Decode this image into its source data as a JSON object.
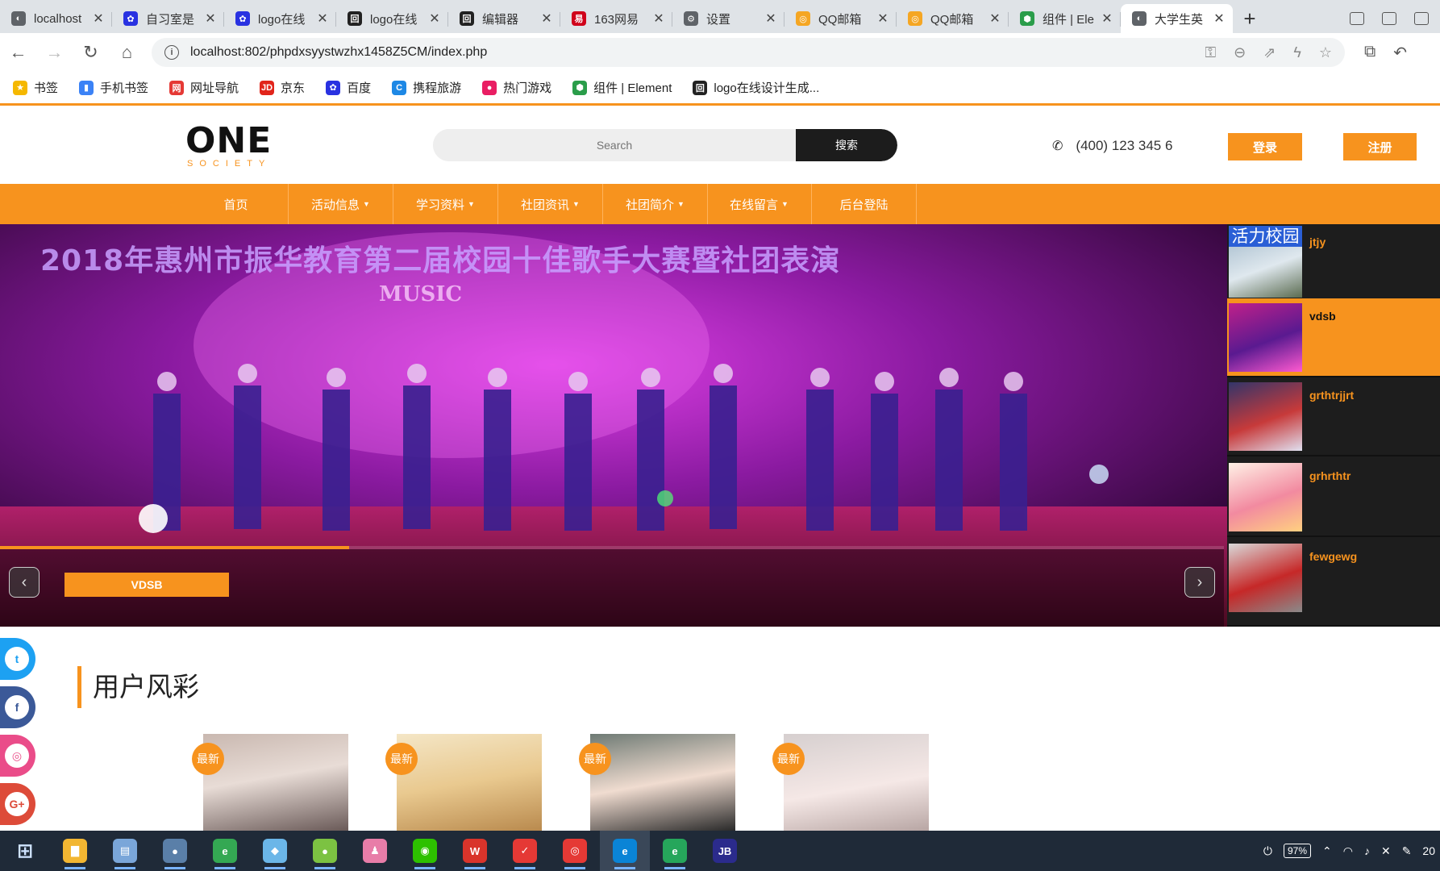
{
  "browser": {
    "tabs": [
      {
        "label": "localhost",
        "favicon_color": "#5f6368",
        "favicon": "◐"
      },
      {
        "label": "自习室是",
        "favicon_color": "#2932e1",
        "favicon": "✿"
      },
      {
        "label": "logo在线",
        "favicon_color": "#2932e1",
        "favicon": "✿"
      },
      {
        "label": "logo在线",
        "favicon_color": "#222222",
        "favicon": "回"
      },
      {
        "label": "编辑器",
        "favicon_color": "#222222",
        "favicon": "回"
      },
      {
        "label": "163网易",
        "favicon_color": "#d0021b",
        "favicon": "易"
      },
      {
        "label": "设置",
        "favicon_color": "#5f6368",
        "favicon": "⚙"
      },
      {
        "label": "QQ邮箱",
        "favicon_color": "#f5a623",
        "favicon": "◎"
      },
      {
        "label": "QQ邮箱",
        "favicon_color": "#f5a623",
        "favicon": "◎"
      },
      {
        "label": "组件 | Ele",
        "favicon_color": "#2a9d4a",
        "favicon": "⬢"
      },
      {
        "label": "大学生英",
        "favicon_color": "#5f6368",
        "favicon": "◐"
      }
    ],
    "active_tab_index": 10,
    "url": "localhost:802/phpdxsyystwzhx1458Z5CM/index.php",
    "bookmarks": [
      {
        "label": "书签",
        "color": "#f5b800",
        "icon": "★"
      },
      {
        "label": "手机书签",
        "color": "#3b82f6",
        "icon": "▮"
      },
      {
        "label": "网址导航",
        "color": "#e53935",
        "icon": "网"
      },
      {
        "label": "京东",
        "color": "#e1251b",
        "icon": "JD"
      },
      {
        "label": "百度",
        "color": "#2932e1",
        "icon": "✿"
      },
      {
        "label": "携程旅游",
        "color": "#1e88e5",
        "icon": "C"
      },
      {
        "label": "热门游戏",
        "color": "#e91e63",
        "icon": "●"
      },
      {
        "label": "组件 | Element",
        "color": "#2a9d4a",
        "icon": "⬢"
      },
      {
        "label": "logo在线设计生成...",
        "color": "#222222",
        "icon": "回"
      }
    ]
  },
  "site": {
    "logo_main": "ONE",
    "logo_sub": "SOCIETY",
    "search_placeholder": "Search",
    "search_button": "搜索",
    "phone": "(400) 123 345 6",
    "login": "登录",
    "register": "注册",
    "accent_color": "#f7931e",
    "nav": [
      {
        "label": "首页",
        "dropdown": false
      },
      {
        "label": "活动信息",
        "dropdown": true
      },
      {
        "label": "学习资料",
        "dropdown": true
      },
      {
        "label": "社团资讯",
        "dropdown": true
      },
      {
        "label": "社团简介",
        "dropdown": true
      },
      {
        "label": "在线留言",
        "dropdown": true
      },
      {
        "label": "后台登陆",
        "dropdown": false
      }
    ]
  },
  "slider": {
    "banner_text": "2018年惠州市振华教育第二届校园十佳歌手大赛暨社团表演",
    "stage_text": "MUSIC",
    "caption": "VDSB",
    "progress": 0.285,
    "prev_icon": "‹",
    "next_icon": "›",
    "side_badge": "活力校园",
    "side_items": [
      {
        "title": "jtjy",
        "active": false
      },
      {
        "title": "vdsb",
        "active": true
      },
      {
        "title": "grthtrjjrt",
        "active": false
      },
      {
        "title": "grhrthtr",
        "active": false
      },
      {
        "title": "fewgewg",
        "active": false
      }
    ]
  },
  "users": {
    "section_title": "用户风彩",
    "badge": "最新",
    "cards": 4
  },
  "social": [
    {
      "name": "twitter",
      "glyph": "t",
      "color": "#1da1f2"
    },
    {
      "name": "facebook",
      "glyph": "f",
      "color": "#3b5998"
    },
    {
      "name": "dribbble",
      "glyph": "◎",
      "color": "#ea4c89"
    },
    {
      "name": "google-plus",
      "glyph": "G+",
      "color": "#dd4b39"
    }
  ],
  "taskbar": {
    "apps": [
      {
        "name": "start",
        "glyph": "⊞",
        "color": "#1f2a38"
      },
      {
        "name": "file-explorer",
        "glyph": "▇",
        "color": "#f2b632"
      },
      {
        "name": "notepad",
        "glyph": "▤",
        "color": "#7aa6d9"
      },
      {
        "name": "avatar-app",
        "glyph": "●",
        "color": "#5a7fa8"
      },
      {
        "name": "browser-green",
        "glyph": "e",
        "color": "#34a853"
      },
      {
        "name": "editor",
        "glyph": "◆",
        "color": "#6bb6e8"
      },
      {
        "name": "frog-app",
        "glyph": "●",
        "color": "#7cc242"
      },
      {
        "name": "figure-app",
        "glyph": "♟",
        "color": "#e87da8"
      },
      {
        "name": "wechat",
        "glyph": "◉",
        "color": "#2dc100"
      },
      {
        "name": "wps",
        "glyph": "W",
        "color": "#d9342b"
      },
      {
        "name": "media-red",
        "glyph": "✓",
        "color": "#e53935"
      },
      {
        "name": "music-red",
        "glyph": "◎",
        "color": "#e53935"
      },
      {
        "name": "edge",
        "glyph": "e",
        "color": "#0a84d6"
      },
      {
        "name": "green-circle",
        "glyph": "e",
        "color": "#26a65b"
      },
      {
        "name": "jetbrains",
        "glyph": "JB",
        "color": "#2b2b8c"
      }
    ],
    "battery": "97%",
    "clock_fragment": "20"
  }
}
